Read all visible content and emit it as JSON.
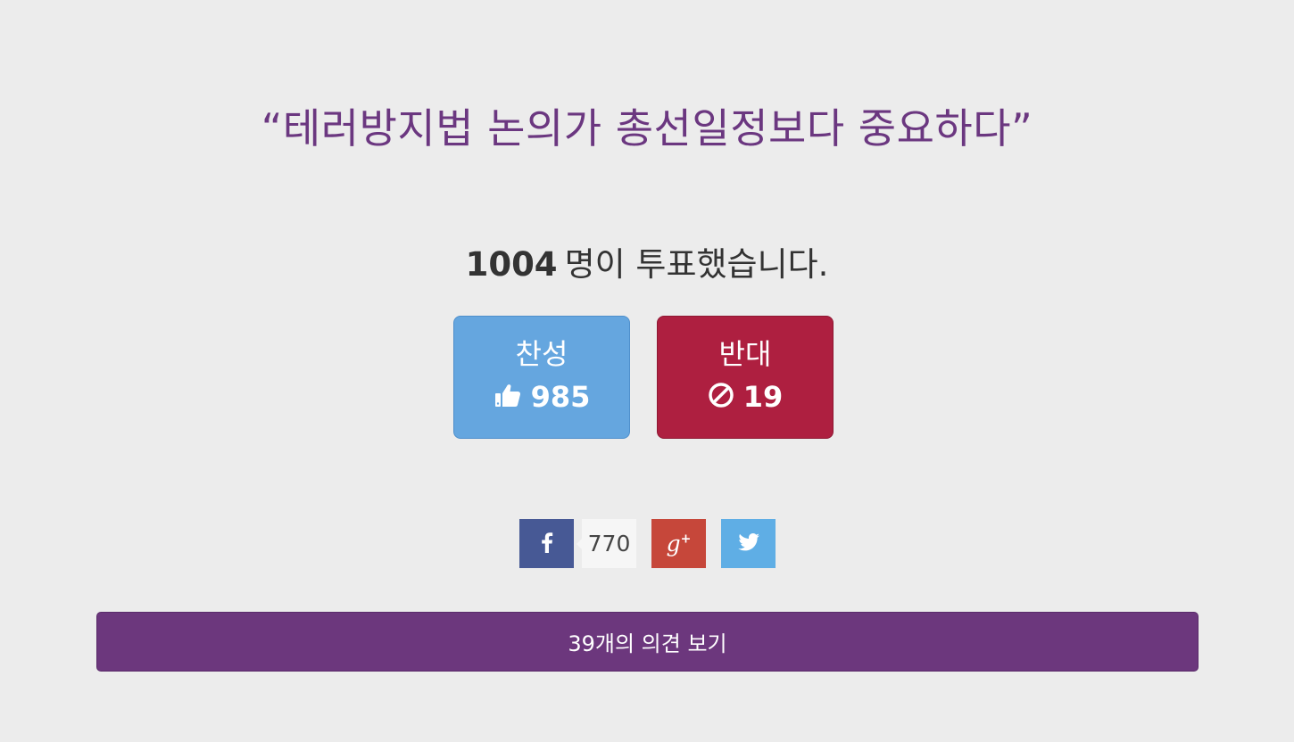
{
  "poll": {
    "title": "“테러방지법 논의가 총선일정보다 중요하다”",
    "voter_count": "1004",
    "voter_suffix": "명이 투표했습니다."
  },
  "votes": {
    "pro": {
      "label": "찬성",
      "count": "985",
      "icon": "thumbs-up-icon",
      "color": "#65a6df"
    },
    "con": {
      "label": "반대",
      "count": "19",
      "icon": "ban-icon",
      "color": "#ae1f40"
    }
  },
  "share": {
    "facebook": {
      "icon": "facebook-icon",
      "count": "770",
      "color": "#475995"
    },
    "google_plus": {
      "icon": "google-plus-icon",
      "glyph": "g",
      "glyph_plus": "+",
      "color": "#c6473a"
    },
    "twitter": {
      "icon": "twitter-icon",
      "color": "#5faee5"
    }
  },
  "opinions": {
    "button_label": "39개의 의견 보기",
    "color": "#6c377d"
  }
}
